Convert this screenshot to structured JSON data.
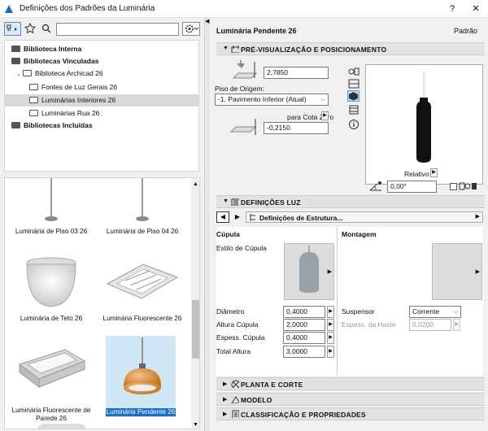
{
  "window": {
    "title": "Definições dos Padrões da Luminária",
    "help": "?",
    "close": "✕"
  },
  "toolbar": {
    "search_placeholder": ""
  },
  "tree": [
    {
      "label": "Biblioteca Interna",
      "bold": true,
      "level": 0,
      "solid": true
    },
    {
      "label": "Bibliotecas Vinculadas",
      "bold": true,
      "level": 0,
      "solid": true
    },
    {
      "label": "Biblioteca Archicad 26",
      "level": 1,
      "exp": "⌄"
    },
    {
      "label": "Fontes de Luz Gerais 26",
      "level": 2
    },
    {
      "label": "Luminárias Interiores 26",
      "level": 2,
      "selected": true
    },
    {
      "label": "Luminárias Rua 26",
      "level": 2
    },
    {
      "label": "Bibliotecas Incluídas",
      "bold": true,
      "level": 0,
      "solid": true
    }
  ],
  "gallery": [
    {
      "label": "Luminária de Piso 03 26"
    },
    {
      "label": "Luminária de Piso 04 26"
    },
    {
      "label": "Luminária de Teto 26"
    },
    {
      "label": "Luminária Fluorescente 26"
    },
    {
      "label": "Luminária Fluorescente de Parede 26"
    },
    {
      "label": "Luminária Pendente 26",
      "selected": true
    }
  ],
  "header": {
    "name": "Luminária Pendente 26",
    "default": "Padrão"
  },
  "preview": {
    "section": "PRÉ-VISUALIZAÇÃO E POSICIONAMENTO",
    "height": "2,7850",
    "origin_label": "Piso de Origem:",
    "origin_value": "-1. Pavimento Inferior (Atual)",
    "zero_label": "para Cota Zero",
    "zero_value": "-0,2150",
    "view_label": "Relativo",
    "angle": "0,00°"
  },
  "light": {
    "section": "DEFINIÇÕES LUZ",
    "page": "Definições de Estrutura...",
    "cupula_title": "Cúpula",
    "montagem_title": "Montagem",
    "style_label": "Estilo de Cúpula",
    "fields": [
      {
        "label": "Diâmetro",
        "value": "0,4000"
      },
      {
        "label": "Altura Cúpula",
        "value": "2,0000"
      },
      {
        "label": "Espess. Cúpula",
        "value": "0,4000"
      },
      {
        "label": "Total Altura",
        "value": "3,0000"
      }
    ],
    "suspensor_label": "Suspensor",
    "suspensor_value": "Corrente",
    "haste_label": "Espess. da Haste",
    "haste_value": "0,0200"
  },
  "sections": [
    "PLANTA E CORTE",
    "MODELO",
    "CLASSIFICAÇÃO E PROPRIEDADES"
  ]
}
